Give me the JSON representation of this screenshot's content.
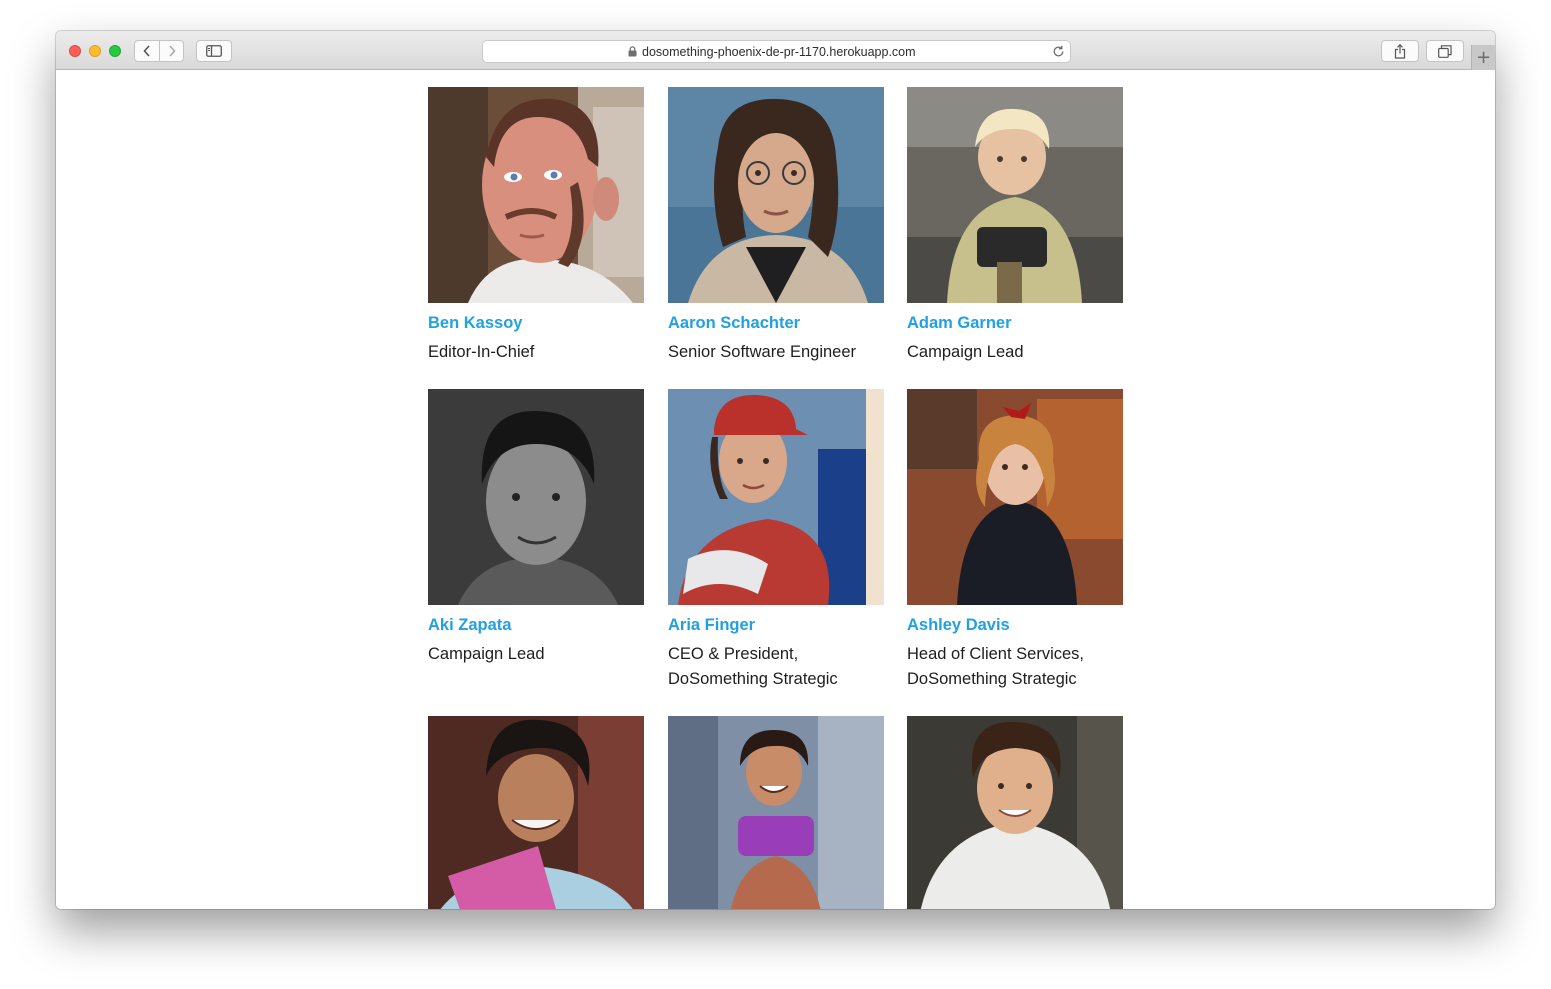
{
  "browser": {
    "url": "dosomething-phoenix-de-pr-1170.herokuapp.com",
    "new_tab_symbol": "+"
  },
  "team": [
    {
      "name": "Ben Kassoy",
      "role": "Editor-In-Chief"
    },
    {
      "name": "Aaron Schachter",
      "role": "Senior Software Engineer"
    },
    {
      "name": "Adam Garner",
      "role": "Campaign Lead"
    },
    {
      "name": "Aki Zapata",
      "role": "Campaign Lead"
    },
    {
      "name": "Aria Finger",
      "role": "CEO & President,\nDoSomething Strategic"
    },
    {
      "name": "Ashley Davis",
      "role": "Head of Client Services,\nDoSomething Strategic"
    },
    {
      "name": "",
      "role": ""
    },
    {
      "name": "",
      "role": ""
    },
    {
      "name": "",
      "role": ""
    }
  ],
  "colors": {
    "name_link": "#21a0e2",
    "role_text": "#1e1e1e"
  }
}
